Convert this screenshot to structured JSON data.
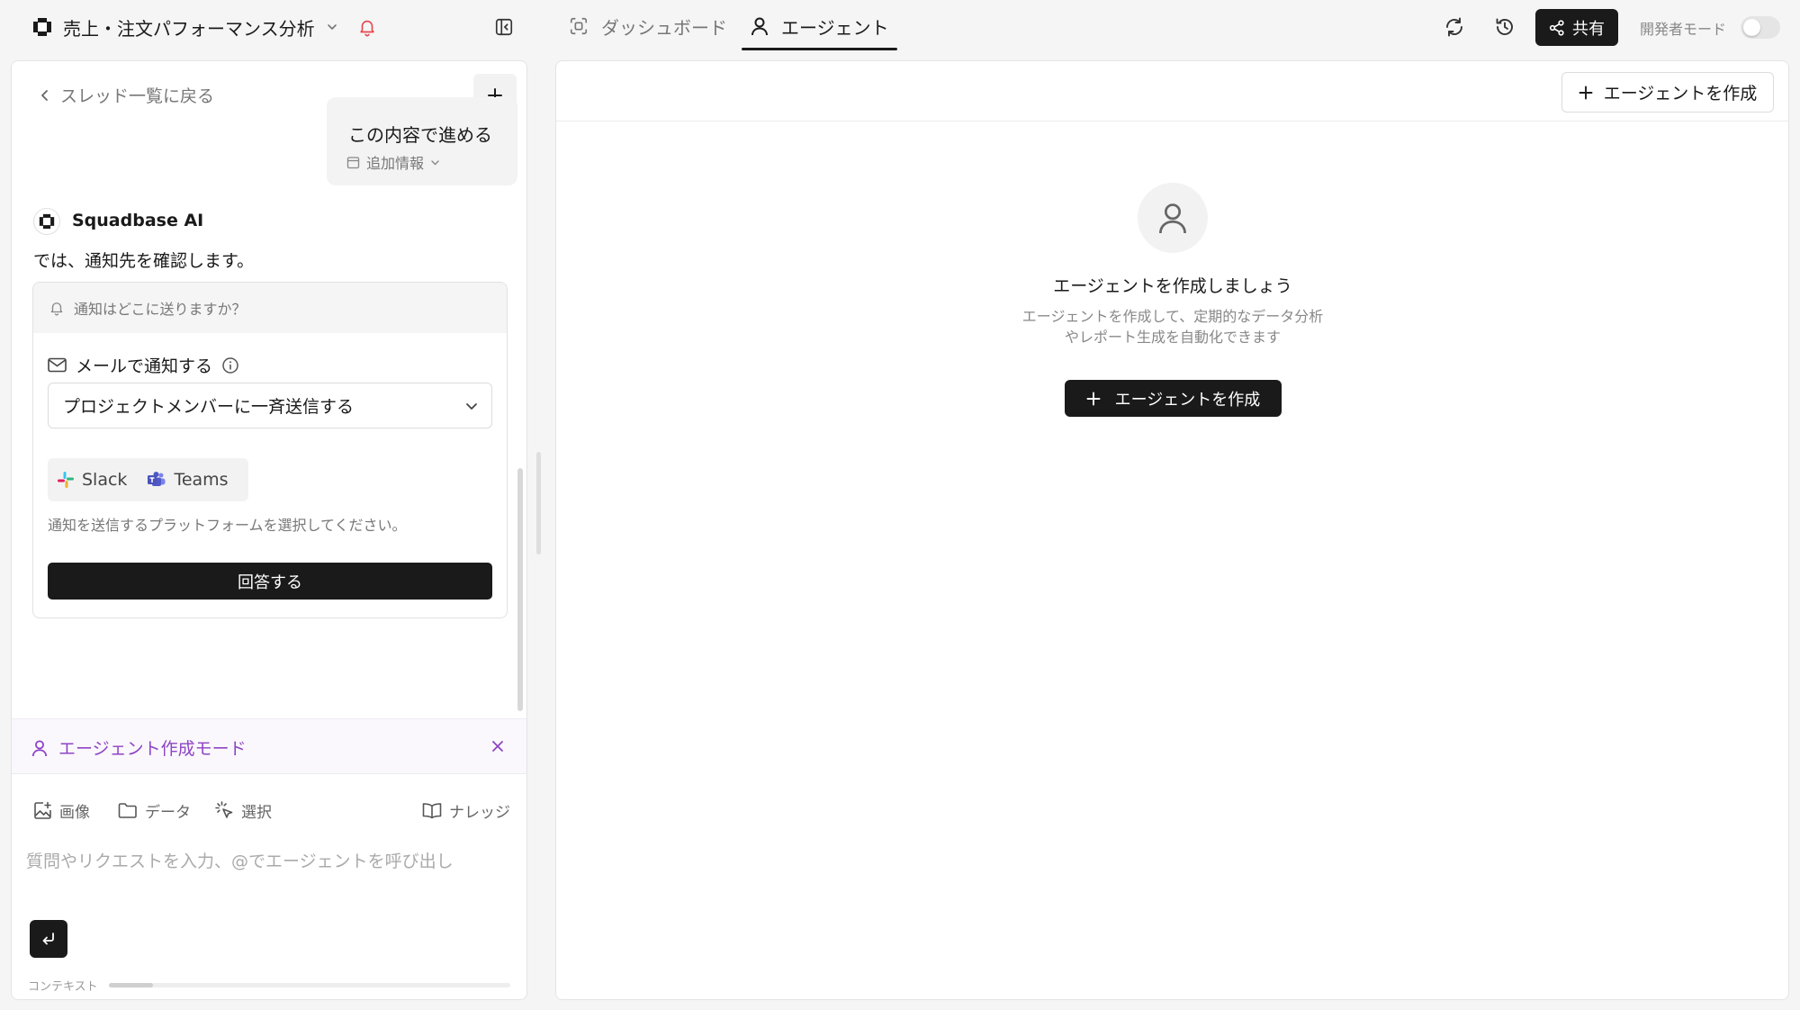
{
  "topbar": {
    "project_title": "売上・注文パフォーマンス分析",
    "tabs": [
      {
        "label": "ダッシュボード",
        "active": false
      },
      {
        "label": "エージェント",
        "active": true
      }
    ],
    "share_label": "共有",
    "dev_mode_label": "開発者モード",
    "dev_mode_on": false
  },
  "thread": {
    "back_label": "スレッド一覧に戻る",
    "user_message": "この内容で進める",
    "extra_info_label": "追加情報",
    "ai_name": "Squadbase AI",
    "ai_message": "では、通知先を確認します。",
    "question": {
      "header": "通知はどこに送りますか？",
      "email_label": "メールで通知する",
      "selected_option": "プロジェクトメンバーに一斉送信する",
      "platforms": [
        "Slack",
        "Teams"
      ],
      "hint": "通知を送信するプラットフォームを選択してください。",
      "answer_label": "回答する"
    }
  },
  "mode": {
    "label": "エージェント作成モード"
  },
  "composer": {
    "tools": {
      "image": "画像",
      "data": "データ",
      "select": "選択",
      "knowledge": "ナレッジ"
    },
    "placeholder": "質問やリクエストを入力、@でエージェントを呼び出し",
    "context_label": "コンテキスト",
    "context_usage": 0.11
  },
  "agents_panel": {
    "create_label": "エージェントを作成",
    "empty_title": "エージェントを作成しましょう",
    "empty_description": "エージェントを作成して、定期的なデータ分析やレポート生成を自動化できます",
    "empty_create_label": "エージェントを作成"
  },
  "colors": {
    "accent_purple": "#8e44c4",
    "primary_dark": "#1a1a1a",
    "bell_red": "#e5484d"
  }
}
